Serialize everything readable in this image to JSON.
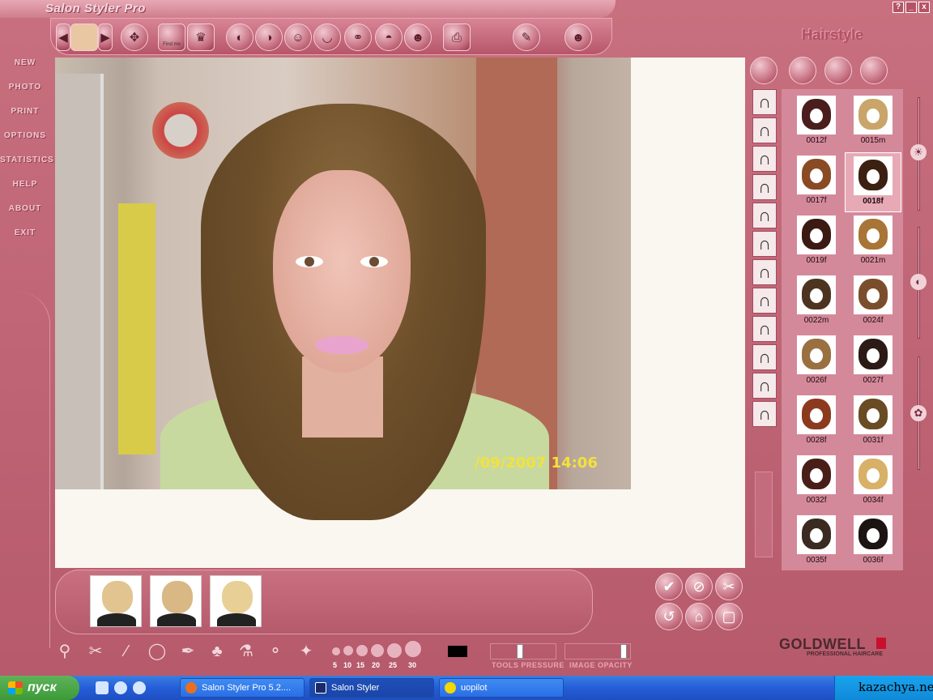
{
  "app": {
    "title": "Salon Styler Pro",
    "window_controls": [
      "?",
      "_",
      "x"
    ]
  },
  "toolbar": {
    "items": [
      {
        "name": "prev-model-icon",
        "glyph": "◀"
      },
      {
        "name": "model-portrait-icon",
        "glyph": ""
      },
      {
        "name": "next-model-icon",
        "glyph": "▶"
      },
      {
        "name": "move-icon",
        "glyph": "✥"
      },
      {
        "name": "photo-id-icon",
        "glyph": "▣"
      },
      {
        "name": "makeup-kit-icon",
        "glyph": "♛"
      },
      {
        "name": "hairstyle-icon",
        "glyph": "◐"
      },
      {
        "name": "sunglasses-icon",
        "glyph": "◑"
      },
      {
        "name": "beard-icon",
        "glyph": "☺"
      },
      {
        "name": "eyebrow-icon",
        "glyph": "◡"
      },
      {
        "name": "jewelry-icon",
        "glyph": "⚭"
      },
      {
        "name": "hat-icon",
        "glyph": "◓"
      },
      {
        "name": "mask-icon",
        "glyph": "☻"
      },
      {
        "name": "printer-icon",
        "glyph": "⎙"
      },
      {
        "name": "undo-shape-icon",
        "glyph": "✎"
      },
      {
        "name": "avatar-icon",
        "glyph": "☻"
      }
    ],
    "print_badge": "Find me"
  },
  "left_menu": [
    "NEW",
    "PHOTO",
    "PRINT",
    "OPTIONS",
    "STATISTICS",
    "HELP",
    "ABOUT",
    "EXIT"
  ],
  "photo": {
    "timestamp": "/09/2007 14:06"
  },
  "right_panel": {
    "title": "Hairstyle",
    "category_buttons": [
      "hair-front-icon",
      "hair-back-icon",
      "monitor-check-icon",
      "color-palette-icon"
    ],
    "styles": [
      {
        "label": "0012f",
        "color": "#4a1e1c"
      },
      {
        "label": "0015m",
        "color": "#c9a56a"
      },
      {
        "label": "0017f",
        "color": "#8a4a24"
      },
      {
        "label": "0018f",
        "color": "#3c2012",
        "selected": true
      },
      {
        "label": "0019f",
        "color": "#3b1a14"
      },
      {
        "label": "0021m",
        "color": "#a87536"
      },
      {
        "label": "0022m",
        "color": "#4d3420"
      },
      {
        "label": "0024f",
        "color": "#7a4e2c"
      },
      {
        "label": "0026f",
        "color": "#9a7040"
      },
      {
        "label": "0027f",
        "color": "#2b1a16"
      },
      {
        "label": "0028f",
        "color": "#8c3a1e"
      },
      {
        "label": "0031f",
        "color": "#6a4c24"
      },
      {
        "label": "0032f",
        "color": "#4a1e18"
      },
      {
        "label": "0034f",
        "color": "#d8b068"
      },
      {
        "label": "0035f",
        "color": "#3a2a20"
      },
      {
        "label": "0036f",
        "color": "#1c1412"
      }
    ],
    "slider_icons": [
      "brightness-icon",
      "contrast-icon",
      "color-icon"
    ]
  },
  "history": {
    "thumbs": [
      {
        "color": "#e2c491"
      },
      {
        "color": "#d9b886"
      },
      {
        "color": "#e8cf95"
      }
    ]
  },
  "actions": [
    {
      "name": "apply-check-icon",
      "glyph": "✔"
    },
    {
      "name": "cancel-slash-icon",
      "glyph": "⊘"
    },
    {
      "name": "delete-scissors-icon",
      "glyph": "✂"
    },
    {
      "name": "rotate-icon",
      "glyph": "↺"
    },
    {
      "name": "flip-icon",
      "glyph": "⌂"
    },
    {
      "name": "frame-icon",
      "glyph": "▢"
    }
  ],
  "tools": {
    "items": [
      {
        "name": "magnifier-icon",
        "glyph": "⚲"
      },
      {
        "name": "scissors-icon",
        "glyph": "✂"
      },
      {
        "name": "comb-icon",
        "glyph": "⁄"
      },
      {
        "name": "lasso-icon",
        "glyph": "◯"
      },
      {
        "name": "pen-icon",
        "glyph": "✒"
      },
      {
        "name": "brush-icon",
        "glyph": "♣"
      },
      {
        "name": "dropper-icon",
        "glyph": "⚗"
      },
      {
        "name": "smudge-icon",
        "glyph": "⚬"
      },
      {
        "name": "magic-wand-icon",
        "glyph": "✦"
      }
    ],
    "brush_sizes": [
      "5",
      "10",
      "15",
      "20",
      "25",
      "30"
    ],
    "tools_pressure_label": "TOOLS PRESSURE",
    "tools_pressure": 0.45,
    "image_opacity_label": "IMAGE OPACITY",
    "image_opacity": 0.95,
    "brush_color": "#000000"
  },
  "brand": {
    "name": "GOLDWELL",
    "tagline": "PROFESSIONAL HAIRCARE"
  },
  "taskbar": {
    "start": "пуск",
    "tasks": [
      {
        "label": "Salon Styler Pro 5.2....",
        "icon_color": "#e87020"
      },
      {
        "label": "Salon Styler",
        "icon_color": "#1a2a6a",
        "active": true
      },
      {
        "label": "uopilot",
        "icon_color": "#f5d800"
      }
    ],
    "tray_text": "kazachya.net"
  }
}
